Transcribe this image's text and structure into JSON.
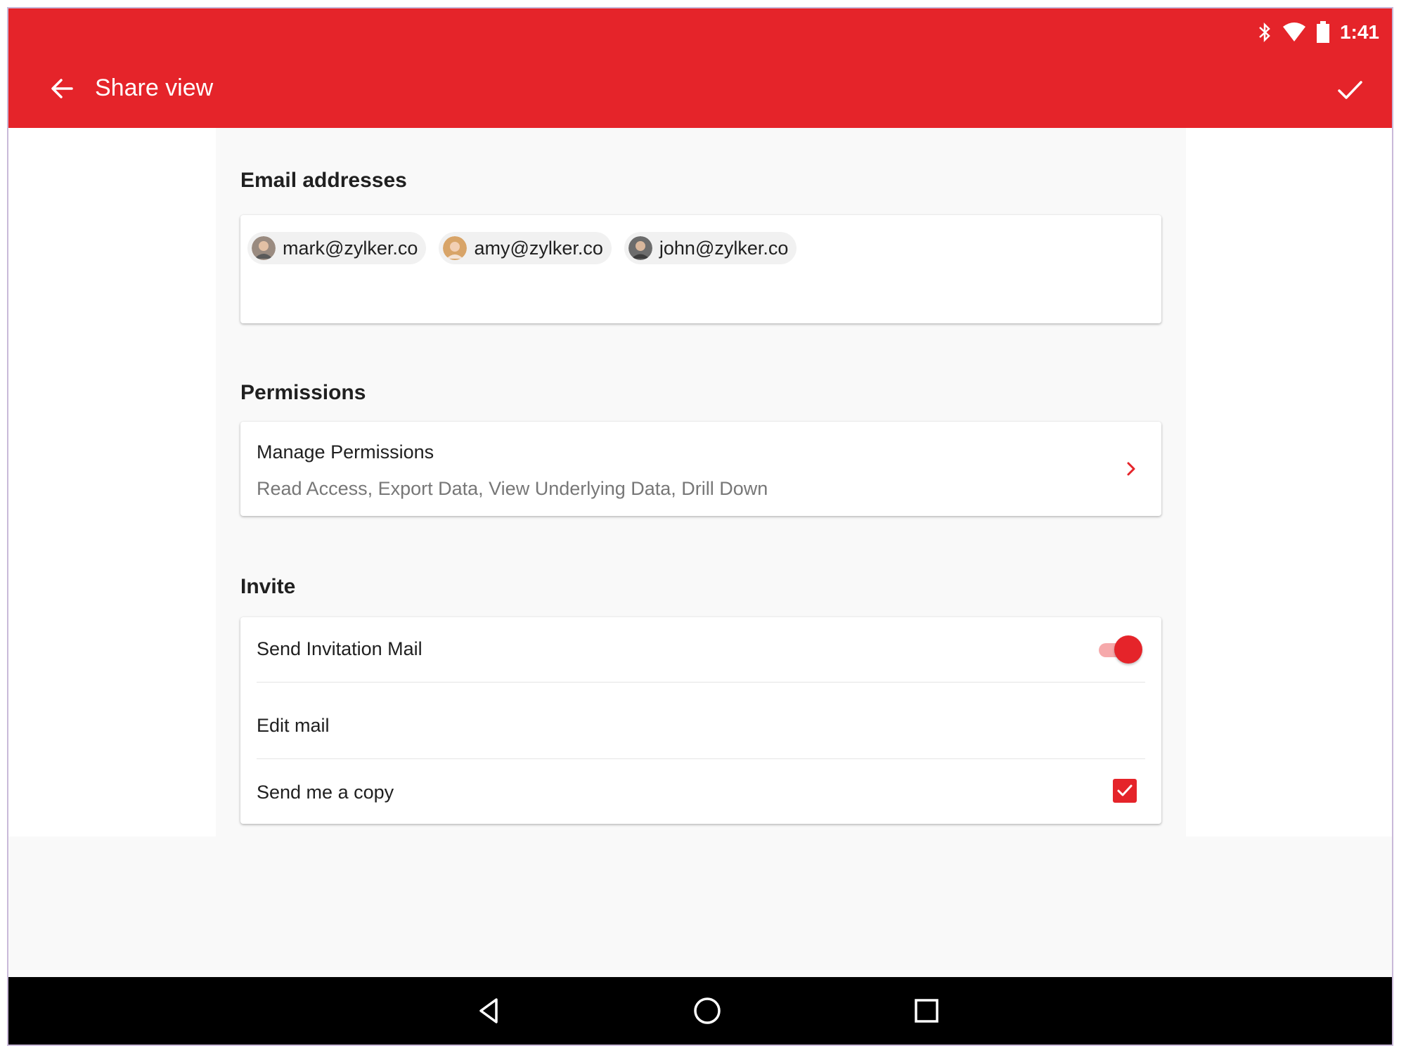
{
  "status_bar": {
    "time": "1:41",
    "icons": [
      "bluetooth-icon",
      "wifi-icon",
      "battery-icon"
    ]
  },
  "app_bar": {
    "title": "Share view",
    "back_icon": "arrow-left-icon",
    "confirm_icon": "check-icon"
  },
  "email_section": {
    "title": "Email addresses",
    "chips": [
      {
        "label": "mark@zylker.co"
      },
      {
        "label": "amy@zylker.co"
      },
      {
        "label": "john@zylker.co"
      }
    ]
  },
  "permissions_section": {
    "title": "Permissions",
    "item_title": "Manage Permissions",
    "item_subtitle": "Read Access, Export Data, View Underlying Data, Drill Down"
  },
  "invite_section": {
    "title": "Invite",
    "send_invitation": {
      "label": "Send Invitation Mail",
      "enabled": true
    },
    "edit_mail": {
      "label": "Edit mail"
    },
    "send_copy": {
      "label": "Send me a copy",
      "checked": true
    }
  },
  "colors": {
    "accent": "#e5242a",
    "accent_light": "#f6a9ab",
    "navbar": "#000000"
  },
  "nav_bar": {
    "icons": [
      "back-triangle-icon",
      "home-circle-icon",
      "recents-square-icon"
    ]
  }
}
